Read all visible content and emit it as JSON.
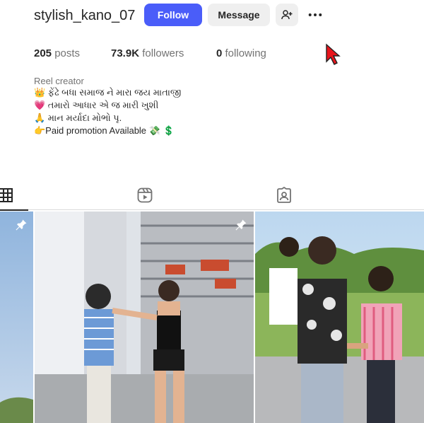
{
  "profile": {
    "username": "stylish_kano_07",
    "follow_label": "Follow",
    "message_label": "Message",
    "adduser_icon": "add-user-icon",
    "more_icon": "more-icon"
  },
  "stats": {
    "posts_count": "205",
    "posts_label": "posts",
    "followers_count": "73.9K",
    "followers_label": "followers",
    "following_count": "0",
    "following_label": "following"
  },
  "bio": {
    "category": "Reel creator",
    "lines": [
      "👑 ફેંઢે બધા સમાજ ને મારા જય માતાજી",
      "💗 તમારો આધાર એ જ મારી ખુશી",
      "🙏 માન મર્યાદા મોભો પૃ.",
      "👉Paid promotion Available 💸 💲"
    ]
  },
  "tabs": {
    "items": [
      "posts-grid-icon",
      "reels-icon",
      "tagged-icon"
    ],
    "active": "posts-grid-icon"
  },
  "colors": {
    "accent": "#4a5df9",
    "button_secondary": "#efefef",
    "text_primary": "#262626",
    "text_secondary": "#737373",
    "cursor": "#e8141b"
  },
  "grid": {
    "posts": [
      {
        "pinned": true
      },
      {
        "pinned": true
      },
      {
        "pinned": false
      }
    ]
  }
}
